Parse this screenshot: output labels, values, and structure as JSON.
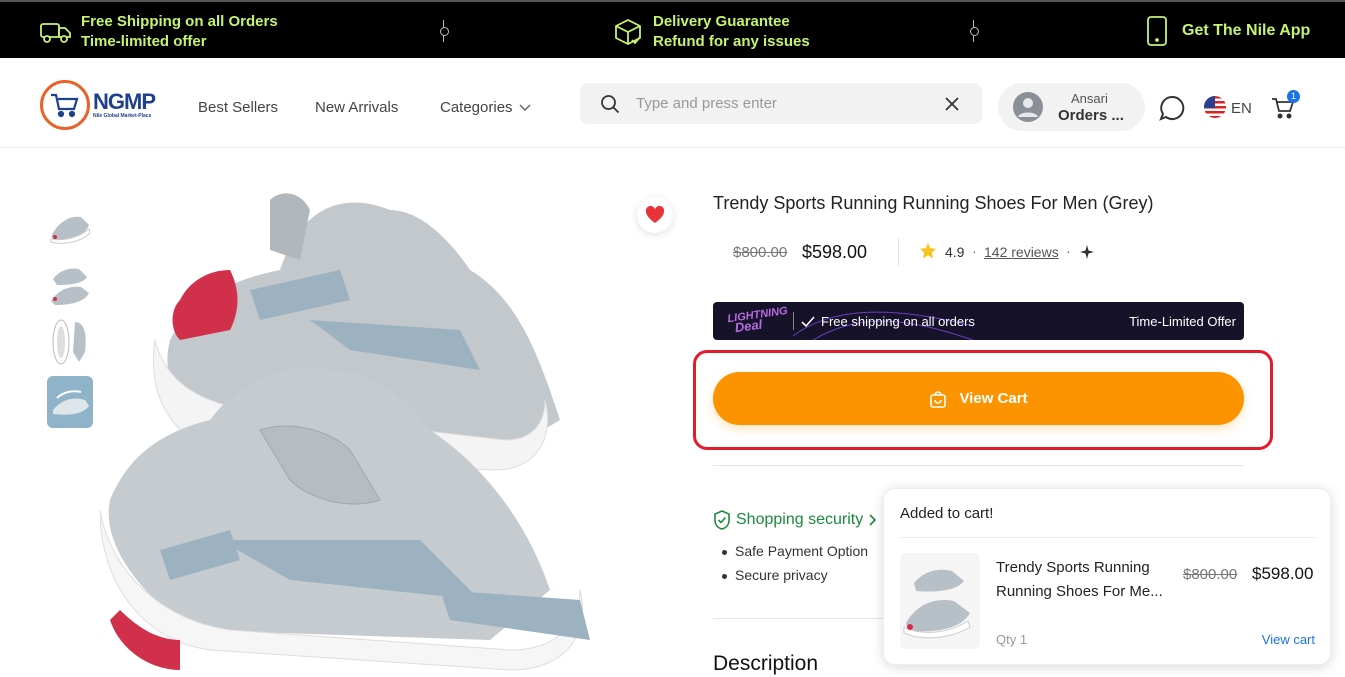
{
  "promo": {
    "shipping_line1": "Free Shipping on all Orders",
    "shipping_line2": "Time-limited offer",
    "delivery_line1": "Delivery Guarantee",
    "delivery_line2": "Refund for any issues",
    "app_text": "Get The Nile App"
  },
  "header": {
    "logo_text": "NGMP",
    "logo_subtext": "Nile Global Market-Place",
    "nav": [
      "Best Sellers",
      "New Arrivals",
      "Categories"
    ],
    "search_placeholder": "Type and press enter",
    "account_name": "Ansari",
    "account_orders": "Orders ...",
    "language": "EN",
    "cart_count": "1"
  },
  "product": {
    "title": "Trendy Sports Running Running Shoes For Men (Grey)",
    "old_price": "$800.00",
    "new_price": "$598.00",
    "rating": "4.9",
    "reviews": "142 reviews",
    "banner_logo_line1": "LIGHTNING",
    "banner_logo_line2": "Deal",
    "banner_free_shipping": "Free shipping on all orders",
    "banner_limited": "Time-Limited Offer",
    "view_cart_label": "View Cart",
    "security_label": "Shopping security",
    "security_points": [
      "Safe Payment Option",
      "Secure privacy"
    ],
    "description_heading": "Description"
  },
  "cart_popup": {
    "title": "Added to cart!",
    "item_name": "Trendy Sports Running Running Shoes For Me...",
    "old_price": "$800.00",
    "new_price": "$598.00",
    "qty": "Qty 1",
    "view_cart_link": "View cart"
  },
  "colors": {
    "promo_accent": "#c6f36f",
    "cta_orange": "#fb9400",
    "highlight_red": "#e01e2b",
    "security_green": "#1a8a3e",
    "link_blue": "#1a73e8"
  },
  "icons": [
    "truck-icon",
    "box-check-icon",
    "phone-icon",
    "search-icon",
    "close-icon",
    "user-icon",
    "chat-icon",
    "us-flag-icon",
    "cart-icon",
    "heart-icon",
    "bag-icon",
    "shield-icon",
    "chevron-right-icon",
    "star-icon",
    "sparkle-icon",
    "chevron-down-icon"
  ]
}
